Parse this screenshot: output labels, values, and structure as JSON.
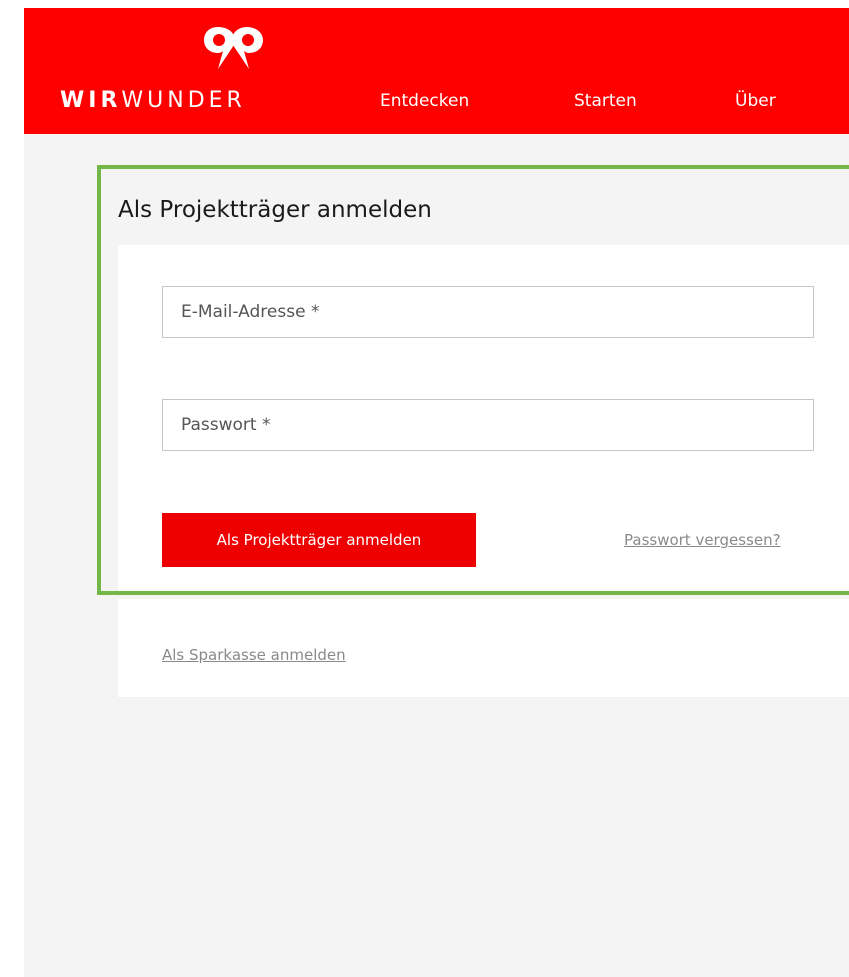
{
  "header": {
    "logo_bold": "WIR",
    "logo_light": "WUNDER",
    "nav": [
      {
        "label": "Entdecken"
      },
      {
        "label": "Starten"
      },
      {
        "label": "Über"
      }
    ],
    "background_color": "#ff0000",
    "logo_icon": "wirwunder-logo-icon"
  },
  "login": {
    "title": "Als Projektträger anmelden",
    "email_placeholder": "E-Mail-Adresse *",
    "email_value": "",
    "password_placeholder": "Passwort *",
    "password_value": "",
    "submit_label": "Als Projektträger anmelden",
    "forgot_label": "Passwort vergessen?",
    "highlight_color": "#74b749",
    "button_color": "#ee0000"
  },
  "alt_login": {
    "sparkasse_label": "Als Sparkasse anmelden"
  }
}
